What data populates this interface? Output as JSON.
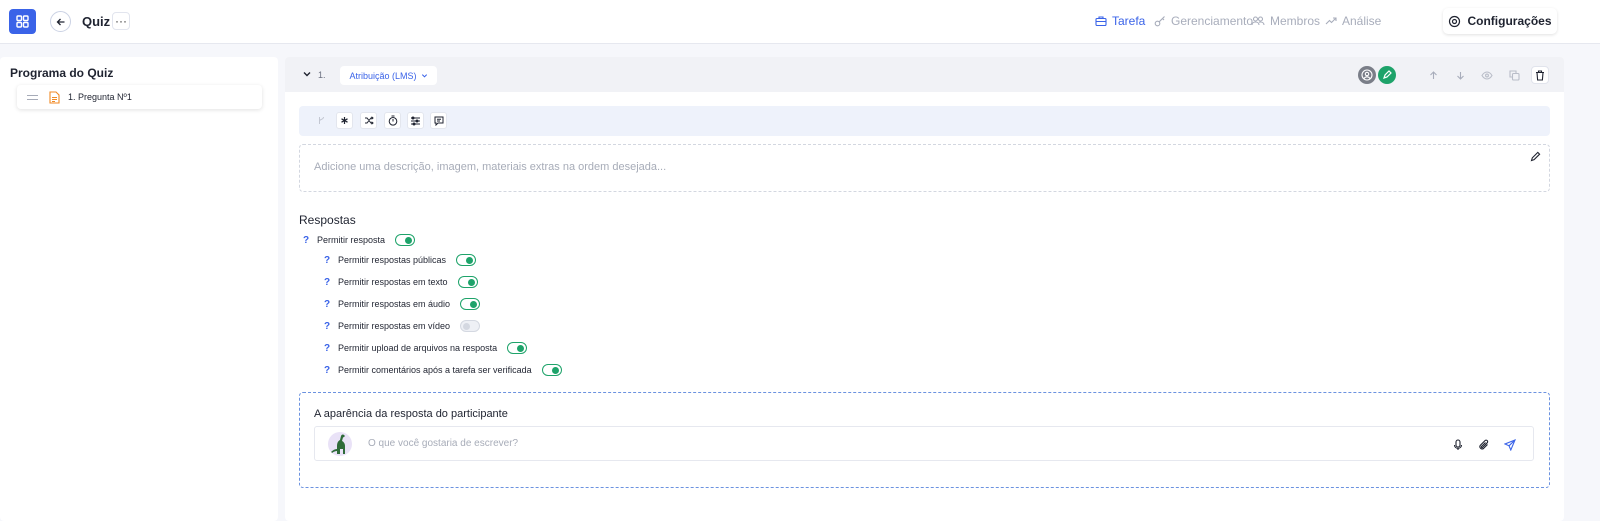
{
  "topbar": {
    "app_title": "Quiz",
    "more_label": "···",
    "nav": [
      {
        "label": "Tarefa",
        "icon": "briefcase-icon",
        "active": true
      },
      {
        "label": "Gerenciamento",
        "icon": "key-icon",
        "active": false
      },
      {
        "label": "Membros",
        "icon": "users-icon",
        "active": false
      },
      {
        "label": "Análise",
        "icon": "trend-icon",
        "active": false
      }
    ],
    "settings_label": "Configurações"
  },
  "sidebar": {
    "title": "Programa do Quiz",
    "items": [
      {
        "label": "1. Pregunta Nº1",
        "icon": "document-icon"
      }
    ]
  },
  "question": {
    "number": "1.",
    "type_label": "Atribuição (LMS)",
    "description_placeholder": "Adicione uma descrição, imagem, materiais extras na ordem desejada...",
    "toolbar_icons": [
      "branch-icon",
      "asterisk-icon",
      "shuffle-icon",
      "timer-icon",
      "sliders-icon",
      "comment-icon"
    ]
  },
  "responses": {
    "title": "Respostas",
    "options": [
      {
        "label": "Permitir resposta",
        "enabled": true
      },
      {
        "label": "Permitir respostas públicas",
        "enabled": true
      },
      {
        "label": "Permitir respostas em texto",
        "enabled": true
      },
      {
        "label": "Permitir respostas em áudio",
        "enabled": true
      },
      {
        "label": "Permitir respostas em vídeo",
        "enabled": false
      },
      {
        "label": "Permitir upload de arquivos na resposta",
        "enabled": true
      },
      {
        "label": "Permitir comentários após a tarefa ser verificada",
        "enabled": true
      }
    ],
    "help_mark": "?"
  },
  "preview": {
    "title": "A aparência da resposta do participante",
    "composer_placeholder": "O que você gostaria de escrever?"
  },
  "colors": {
    "accent": "#3a63e8",
    "toggle_on": "#1ea36a",
    "toggle_off": "#d4d8e1"
  }
}
